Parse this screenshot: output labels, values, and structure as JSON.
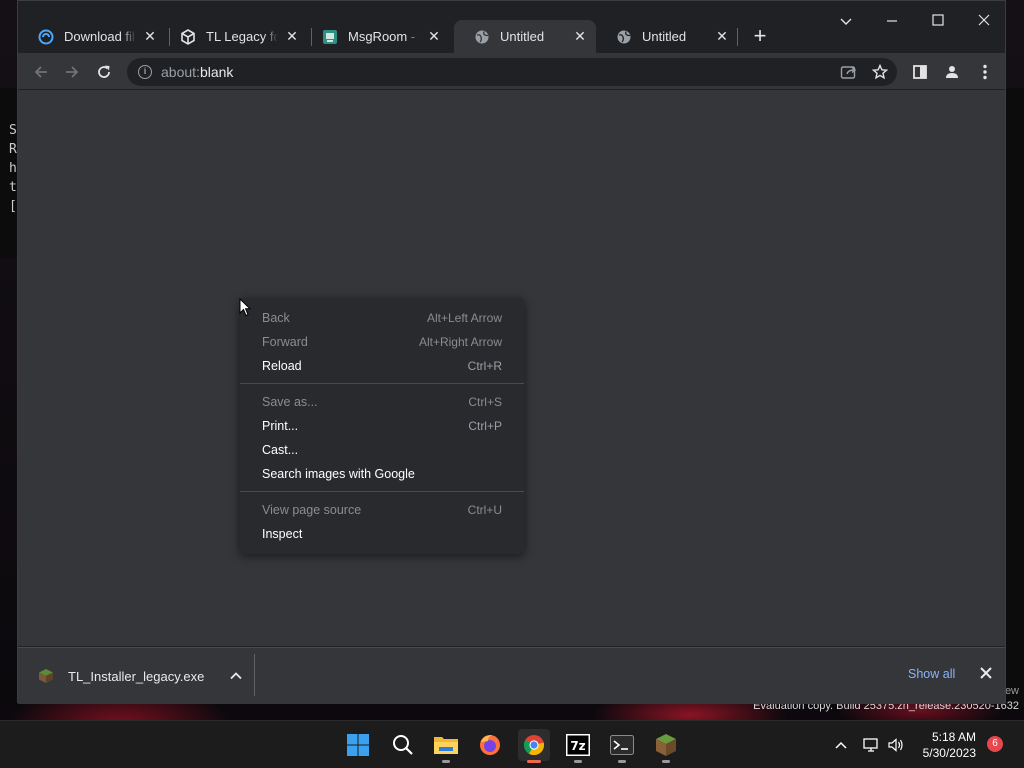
{
  "desktop": {
    "terminal_lines": [
      "S",
      "R",
      "h",
      "t",
      "["
    ],
    "watermark_first": "ew",
    "watermark": "Evaluation copy. Build 25375.zn_release.230520-1632"
  },
  "browser": {
    "tabs": [
      {
        "title": "Download file",
        "icon": "swirl-download-icon"
      },
      {
        "title": "TL Legacy for I",
        "icon": "tl-cube-icon"
      },
      {
        "title": "MsgRoom - W",
        "icon": "msgroom-icon"
      },
      {
        "title": "Untitled",
        "icon": "globe-icon",
        "active": true
      },
      {
        "title": "Untitled",
        "icon": "globe-icon"
      }
    ],
    "address": {
      "scheme": "about:",
      "host": "blank"
    },
    "context_menu": {
      "items": [
        {
          "label": "Back",
          "shortcut": "Alt+Left Arrow",
          "enabled": false
        },
        {
          "label": "Forward",
          "shortcut": "Alt+Right Arrow",
          "enabled": false
        },
        {
          "label": "Reload",
          "shortcut": "Ctrl+R",
          "enabled": true
        },
        {
          "label": "Save as...",
          "shortcut": "Ctrl+S",
          "enabled": false
        },
        {
          "label": "Print...",
          "shortcut": "Ctrl+P",
          "enabled": true
        },
        {
          "label": "Cast...",
          "shortcut": "",
          "enabled": true
        },
        {
          "label": "Search images with Google",
          "shortcut": "",
          "enabled": true
        },
        {
          "label": "View page source",
          "shortcut": "Ctrl+U",
          "enabled": false
        },
        {
          "label": "Inspect",
          "shortcut": "",
          "enabled": true
        }
      ]
    },
    "download_shelf": {
      "filename": "TL_Installer_legacy.exe",
      "show_all": "Show all"
    }
  },
  "taskbar": {
    "apps": [
      "start-icon",
      "search-icon",
      "file-explorer-icon",
      "firefox-icon",
      "chrome-icon",
      "7zip-icon",
      "terminal-icon",
      "minecraft-icon"
    ],
    "time": "5:18 AM",
    "date": "5/30/2023",
    "notifications": "6"
  },
  "colors": {
    "accent": "#8ab4f8",
    "chrome_dark": "#202124",
    "chrome_surface": "#35363a"
  }
}
